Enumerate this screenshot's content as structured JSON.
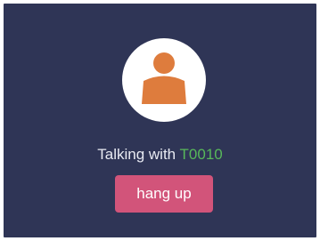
{
  "call": {
    "status_prefix": "Talking with ",
    "peer_id": "T0010",
    "hangup_label": "hang up"
  },
  "icons": {
    "avatar": "person-icon"
  },
  "colors": {
    "background": "#2f3556",
    "avatar_circle": "#ffffff",
    "avatar_figure": "#de7c3d",
    "peer_id": "#58b85a",
    "hangup_button": "#d2547a",
    "text": "#e8eaf2"
  }
}
